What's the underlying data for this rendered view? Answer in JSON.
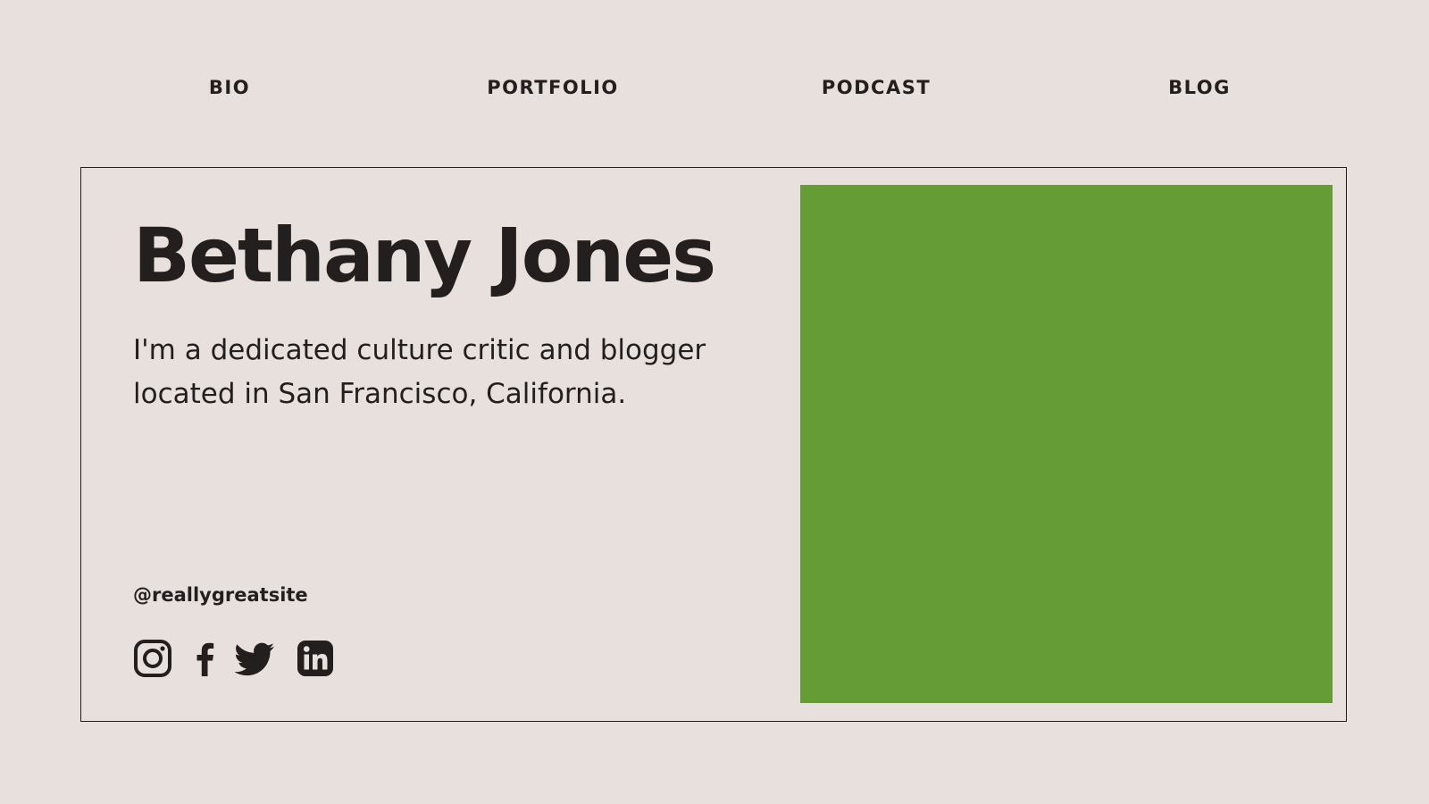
{
  "nav": {
    "items": [
      {
        "label": "BIO"
      },
      {
        "label": "PORTFOLIO"
      },
      {
        "label": "PODCAST"
      },
      {
        "label": "BLOG"
      }
    ]
  },
  "profile": {
    "name": "Bethany Jones",
    "description": "I'm a dedicated culture critic and blogger located in San Francisco, California.",
    "handle": "@reallygreatsite"
  },
  "socials": [
    {
      "icon": "instagram-icon"
    },
    {
      "icon": "facebook-icon"
    },
    {
      "icon": "twitter-icon"
    },
    {
      "icon": "linkedin-icon"
    }
  ],
  "colors": {
    "background": "#e8e0dc",
    "text": "#231f1e",
    "photo_placeholder": "#659c35"
  }
}
